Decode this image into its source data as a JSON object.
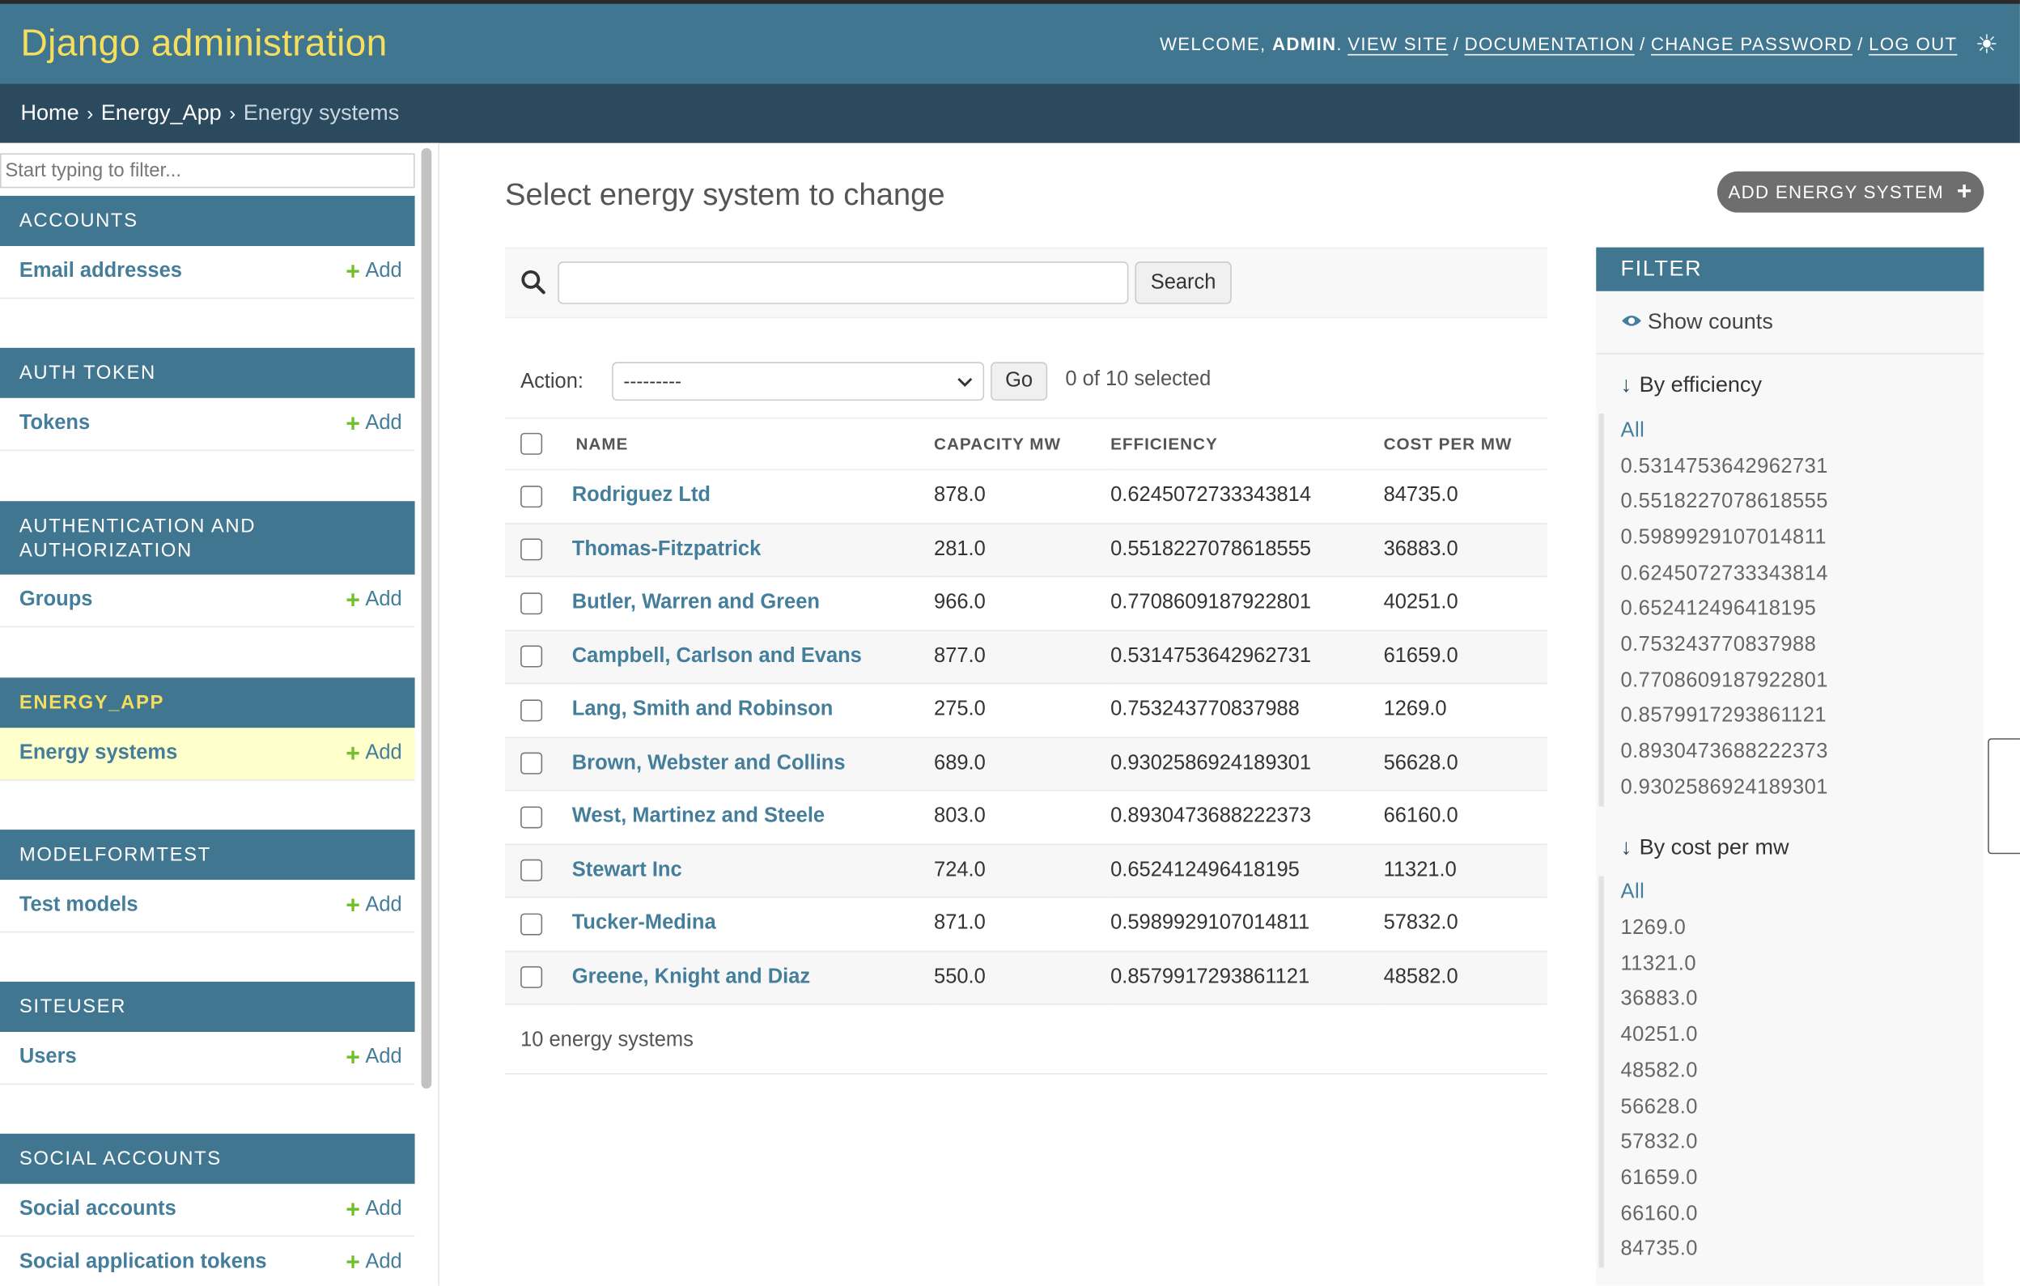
{
  "header": {
    "branding": "Django administration",
    "welcome_prefix": "WELCOME, ",
    "username": "ADMIN",
    "welcome_suffix": ".",
    "links": [
      "VIEW SITE",
      "DOCUMENTATION",
      "CHANGE PASSWORD",
      "LOG OUT"
    ],
    "separator": "/",
    "theme_icon": "☀"
  },
  "breadcrumbs": {
    "home": "Home",
    "app": "Energy_App",
    "current": "Energy systems",
    "arrow": "›"
  },
  "sidebar": {
    "filter_placeholder": "Start typing to filter...",
    "add_label": "Add",
    "add_icon": "+",
    "modules": [
      {
        "title": "ACCOUNTS",
        "models": [
          "Email addresses"
        ]
      },
      {
        "title": "AUTH TOKEN",
        "models": [
          "Tokens"
        ]
      },
      {
        "title": "AUTHENTICATION AND AUTHORIZATION",
        "models": [
          "Groups"
        ]
      },
      {
        "title": "ENERGY_APP",
        "models": [
          "Energy systems"
        ],
        "current": true
      },
      {
        "title": "MODELFORMTEST",
        "models": [
          "Test models"
        ]
      },
      {
        "title": "SITEUSER",
        "models": [
          "Users"
        ]
      },
      {
        "title": "SOCIAL ACCOUNTS",
        "models": [
          "Social accounts",
          "Social application tokens"
        ]
      }
    ]
  },
  "main": {
    "title": "Select energy system to change",
    "add_button": "ADD ENERGY SYSTEM",
    "add_button_icon": "+",
    "search_button": "Search",
    "search_value": "",
    "action_label": "Action:",
    "action_selected": "---------",
    "go_button": "Go",
    "selection_count": "0 of 10 selected",
    "columns": [
      "NAME",
      "CAPACITY MW",
      "EFFICIENCY",
      "COST PER MW"
    ],
    "rows": [
      [
        "Rodriguez Ltd",
        "878.0",
        "0.6245072733343814",
        "84735.0"
      ],
      [
        "Thomas-Fitzpatrick",
        "281.0",
        "0.5518227078618555",
        "36883.0"
      ],
      [
        "Butler, Warren and Green",
        "966.0",
        "0.7708609187922801",
        "40251.0"
      ],
      [
        "Campbell, Carlson and Evans",
        "877.0",
        "0.5314753642962731",
        "61659.0"
      ],
      [
        "Lang, Smith and Robinson",
        "275.0",
        "0.753243770837988",
        "1269.0"
      ],
      [
        "Brown, Webster and Collins",
        "689.0",
        "0.9302586924189301",
        "56628.0"
      ],
      [
        "West, Martinez and Steele",
        "803.0",
        "0.8930473688222373",
        "66160.0"
      ],
      [
        "Stewart Inc",
        "724.0",
        "0.652412496418195",
        "11321.0"
      ],
      [
        "Tucker-Medina",
        "871.0",
        "0.5989929107014811",
        "57832.0"
      ],
      [
        "Greene, Knight and Diaz",
        "550.0",
        "0.8579917293861121",
        "48582.0"
      ]
    ],
    "paginator": "10 energy systems"
  },
  "filter": {
    "title": "FILTER",
    "show_counts": "Show counts",
    "by_efficiency": "By efficiency",
    "efficiency_options": [
      "All",
      "0.5314753642962731",
      "0.5518227078618555",
      "0.5989929107014811",
      "0.6245072733343814",
      "0.652412496418195",
      "0.753243770837988",
      "0.7708609187922801",
      "0.8579917293861121",
      "0.8930473688222373",
      "0.9302586924189301"
    ],
    "by_cost": "By cost per mw",
    "cost_options": [
      "All",
      "1269.0",
      "11321.0",
      "36883.0",
      "40251.0",
      "48582.0",
      "56628.0",
      "57832.0",
      "61659.0",
      "66160.0",
      "84735.0"
    ]
  },
  "colors": {
    "header_bg": "#417690",
    "branding": "#f5dd5d",
    "breadcrumb_bg": "#2c4a5e",
    "link": "#447e9b",
    "add_plus": "#70bf2b",
    "selected_row": "#ffffcc"
  },
  "icons": {
    "search": "search-icon",
    "theme": "sun-icon",
    "eye": "eye-icon",
    "down": "arrow-down-icon",
    "plus": "plus-icon",
    "chevron": "chevron-down-icon"
  }
}
